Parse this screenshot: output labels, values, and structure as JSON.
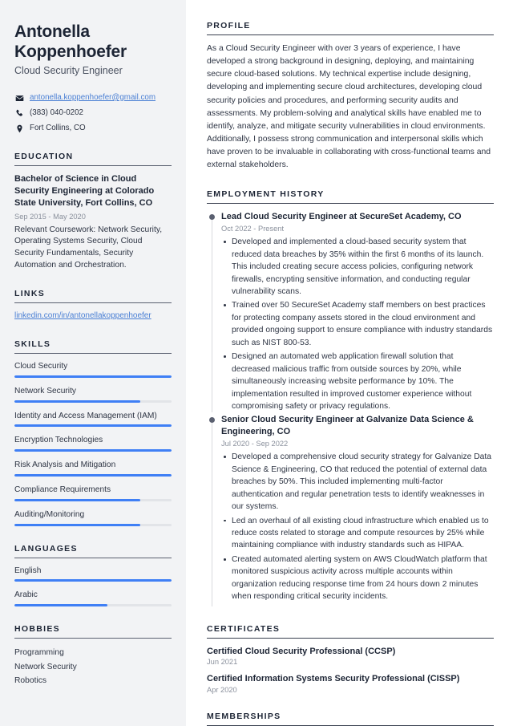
{
  "header": {
    "first_name": "Antonella",
    "last_name": "Koppenhoefer",
    "job_title": "Cloud Security Engineer",
    "contacts": [
      {
        "icon": "envelope-icon",
        "text": "antonella.koppenhoefer@gmail.com",
        "is_link": true
      },
      {
        "icon": "phone-icon",
        "text": "(383) 040-0202",
        "is_link": false
      },
      {
        "icon": "location-pin-icon",
        "text": "Fort Collins, CO",
        "is_link": false
      }
    ]
  },
  "sidebar": {
    "education": {
      "heading": "EDUCATION",
      "degree": "Bachelor of Science in Cloud Security Engineering at Colorado State University, Fort Collins, CO",
      "date": "Sep 2015 - May 2020",
      "description": "Relevant Coursework: Network Security, Operating Systems Security, Cloud Security Fundamentals, Security Automation and Orchestration."
    },
    "links": {
      "heading": "LINKS",
      "items": [
        {
          "label": "linkedin.com/in/antonellakoppenhoefer"
        }
      ]
    },
    "skills": {
      "heading": "SKILLS",
      "items": [
        {
          "label": "Cloud Security",
          "level": 100
        },
        {
          "label": "Network Security",
          "level": 80
        },
        {
          "label": "Identity and Access Management (IAM)",
          "level": 100
        },
        {
          "label": "Encryption Technologies",
          "level": 100
        },
        {
          "label": "Risk Analysis and Mitigation",
          "level": 100
        },
        {
          "label": "Compliance Requirements",
          "level": 80
        },
        {
          "label": "Auditing/Monitoring",
          "level": 80
        }
      ]
    },
    "languages": {
      "heading": "LANGUAGES",
      "items": [
        {
          "label": "English",
          "level": 100
        },
        {
          "label": "Arabic",
          "level": 59
        }
      ]
    },
    "hobbies": {
      "heading": "HOBBIES",
      "items": [
        {
          "label": "Programming"
        },
        {
          "label": "Network Security"
        },
        {
          "label": "Robotics"
        }
      ]
    }
  },
  "main": {
    "profile": {
      "heading": "PROFILE",
      "text": "As a Cloud Security Engineer with over 3 years of experience, I have developed a strong background in designing, deploying, and maintaining secure cloud-based solutions. My technical expertise include designing, developing and implementing secure cloud architectures, developing cloud security policies and procedures, and performing security audits and assessments. My problem-solving and analytical skills have enabled me to identify, analyze, and mitigate security vulnerabilities in cloud environments. Additionally, I possess strong communication and interpersonal skills which have proven to be invaluable in collaborating with cross-functional teams and external stakeholders."
    },
    "employment": {
      "heading": "EMPLOYMENT HISTORY",
      "entries": [
        {
          "title": "Lead Cloud Security Engineer at SecureSet Academy, CO",
          "date": "Oct 2022 - Present",
          "bullets": [
            "Developed and implemented a cloud-based security system that reduced data breaches by 35% within the first 6 months of its launch. This included creating secure access policies, configuring network firewalls, encrypting sensitive information, and conducting regular vulnerability scans.",
            "Trained over 50 SecureSet Academy staff members on best practices for protecting company assets stored in the cloud environment and provided ongoing support to ensure compliance with industry standards such as NIST 800-53.",
            "Designed an automated web application firewall solution that decreased malicious traffic from outside sources by 20%, while simultaneously increasing website performance by 10%. The implementation resulted in improved customer experience without compromising safety or privacy regulations."
          ]
        },
        {
          "title": "Senior Cloud Security Engineer at Galvanize Data Science & Engineering, CO",
          "date": "Jul 2020 - Sep 2022",
          "bullets": [
            "Developed a comprehensive cloud security strategy for Galvanize Data Science & Engineering, CO that reduced the potential of external data breaches by 50%. This included implementing multi-factor authentication and regular penetration tests to identify weaknesses in our systems.",
            "Led an overhaul of all existing cloud infrastructure which enabled us to reduce costs related to storage and compute resources by 25% while maintaining compliance with industry standards such as HIPAA.",
            "Created automated alerting system on AWS CloudWatch platform that monitored suspicious activity across multiple accounts within organization reducing response time from 24 hours down 2 minutes when responding critical security incidents."
          ]
        }
      ]
    },
    "certificates": {
      "heading": "CERTIFICATES",
      "items": [
        {
          "name": "Certified Cloud Security Professional (CCSP)",
          "date": "Jun 2021"
        },
        {
          "name": "Certified Information Systems Security Professional (CISSP)",
          "date": "Apr 2020"
        }
      ]
    },
    "memberships": {
      "heading": "MEMBERSHIPS"
    }
  },
  "theme": {
    "accent": "#3f7ff5",
    "link": "#4a7fd4",
    "sidebar_bg": "#f2f3f5",
    "text": "#2e3544",
    "heading": "#1c2434",
    "muted": "#8a909c"
  }
}
